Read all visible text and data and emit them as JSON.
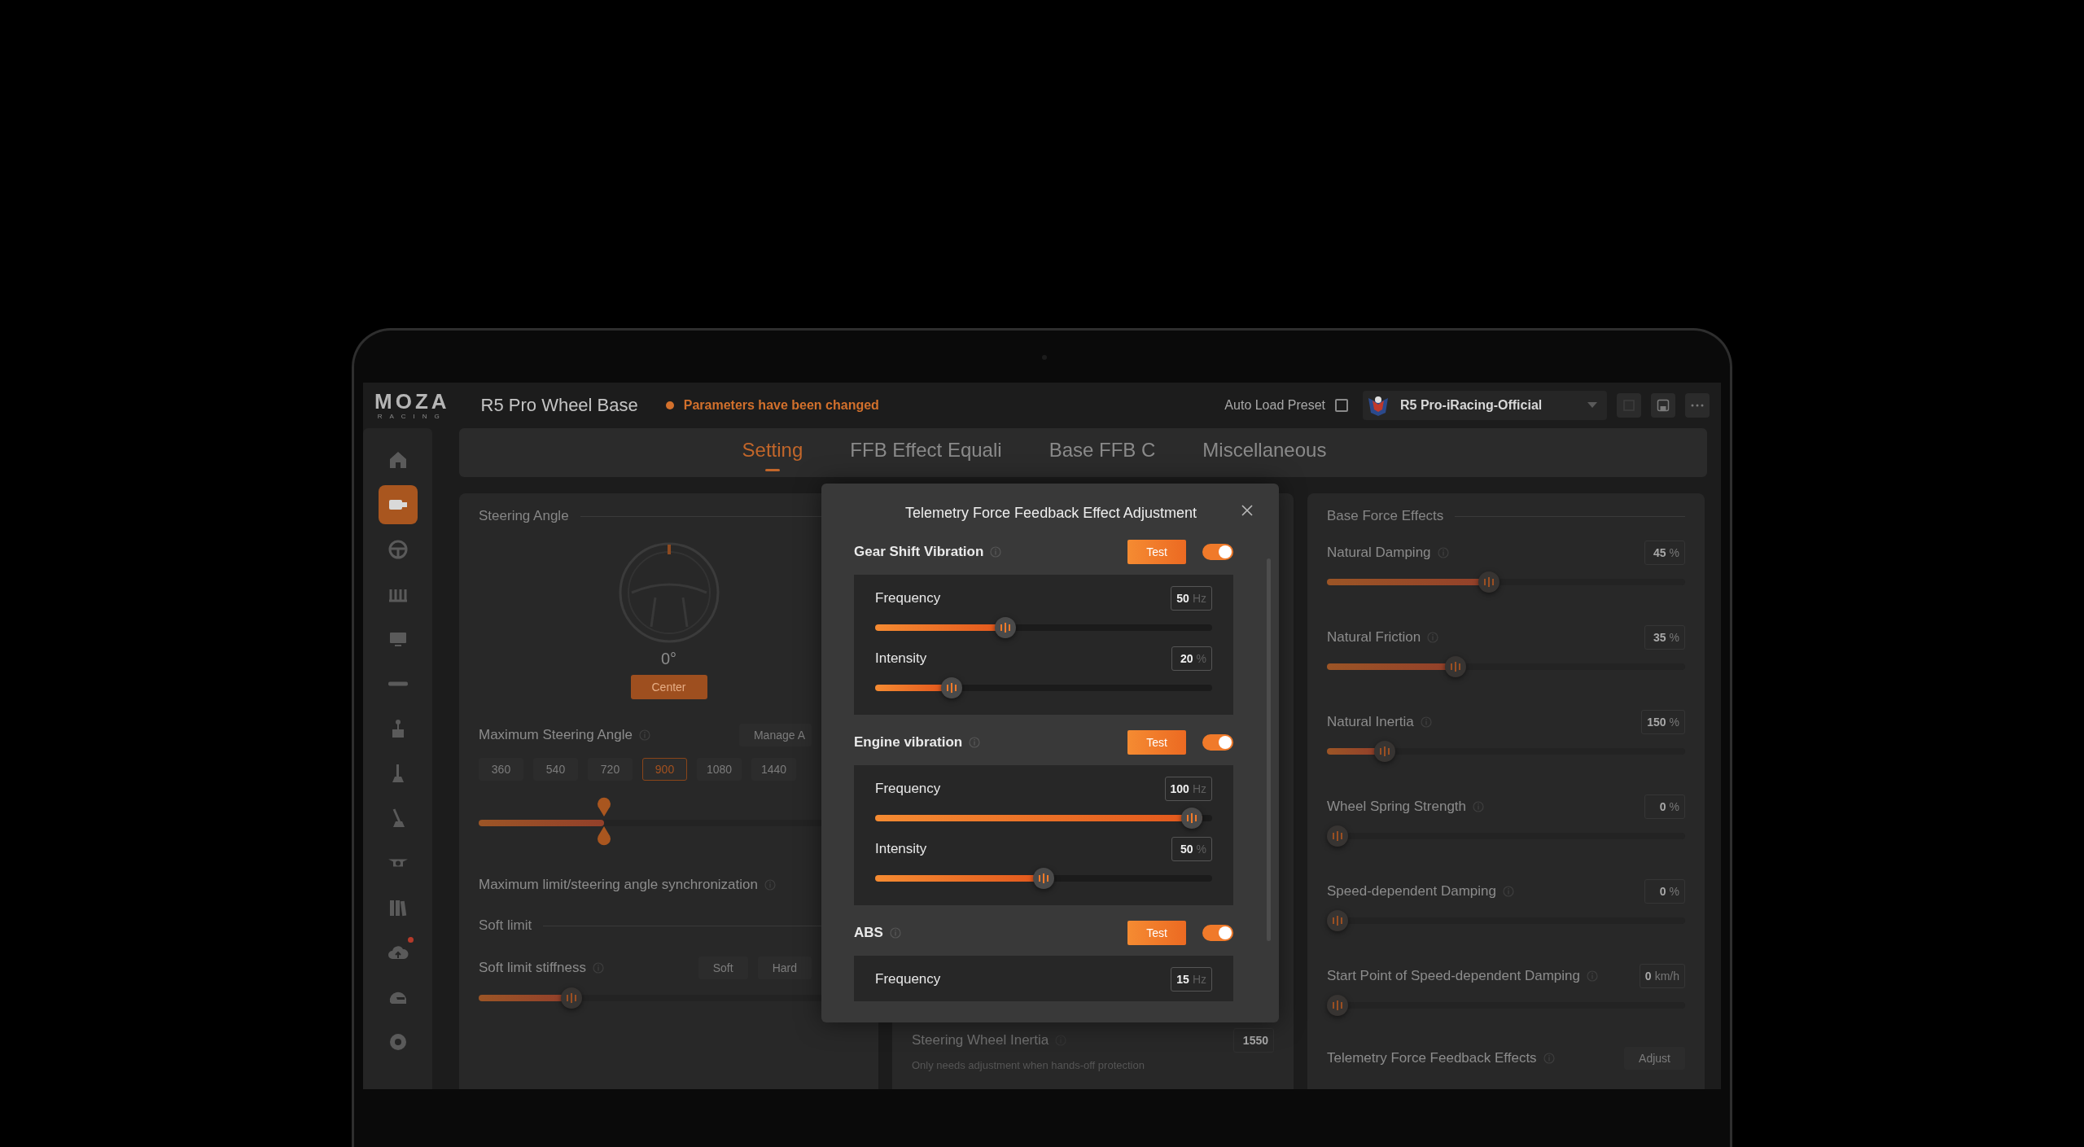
{
  "title_bar": {
    "logo": "MOZA",
    "logo_tagline": "RACING",
    "device": "R5 Pro Wheel Base",
    "status": "Parameters have been changed",
    "auto_load_preset": {
      "label": "Auto Load Preset",
      "checked": false
    },
    "preset": "R5 Pro-iRacing-Official"
  },
  "sidebar": {
    "items": [
      {
        "kind": "home",
        "selected": false,
        "notification": false
      },
      {
        "kind": "wheelbase",
        "selected": true,
        "notification": false
      },
      {
        "kind": "wheel",
        "selected": false,
        "notification": false
      },
      {
        "kind": "pedals",
        "selected": false,
        "notification": false
      },
      {
        "kind": "dashboard",
        "selected": false,
        "notification": false
      },
      {
        "kind": "bar",
        "selected": false,
        "notification": false
      },
      {
        "kind": "shifter",
        "selected": false,
        "notification": false
      },
      {
        "kind": "handbrake",
        "selected": false,
        "notification": false
      },
      {
        "kind": "lever",
        "selected": false,
        "notification": false
      },
      {
        "kind": "rim",
        "selected": false,
        "notification": false
      },
      {
        "kind": "library",
        "selected": false,
        "notification": false
      },
      {
        "kind": "cloud",
        "selected": false,
        "notification": true
      },
      {
        "kind": "helmet",
        "selected": false,
        "notification": false
      },
      {
        "kind": "settings",
        "selected": false,
        "notification": false
      }
    ]
  },
  "tabs": [
    {
      "label": "Setting",
      "selected": true
    },
    {
      "label": "FFB Effect Equali",
      "selected": false
    },
    {
      "label": "Base FFB C",
      "selected": false
    },
    {
      "label": "Miscellaneous",
      "selected": false
    }
  ],
  "steering_panel": {
    "title": "Steering Angle",
    "angle": "0°",
    "center_button": "Center",
    "max_angle_label": "Maximum Steering Angle",
    "manage_button": "Manage A",
    "angle_options": [
      {
        "label": "360",
        "selected": false
      },
      {
        "label": "540",
        "selected": false
      },
      {
        "label": "720",
        "selected": false
      },
      {
        "label": "900",
        "selected": true
      },
      {
        "label": "1080",
        "selected": false
      },
      {
        "label": "1440",
        "selected": false
      }
    ],
    "angle_slider": {
      "level": 0.31
    },
    "sync_label": "Maximum limit/steering angle synchronization",
    "soft_limit_title": "Soft limit",
    "stiffness_label": "Soft limit stiffness",
    "stiffness_options": [
      "Soft",
      "Hard"
    ],
    "stiffness_slider": {
      "level": 0.23
    }
  },
  "middle_panel": {
    "label": "Steering Wheel Inertia",
    "value": "1550",
    "description": "Only needs adjustment when hands-off protection"
  },
  "base_force_panel": {
    "title": "Base Force Effects",
    "settings": [
      {
        "label": "Natural Damping",
        "value": "45",
        "unit": "%",
        "level": 0.45
      },
      {
        "label": "Natural Friction",
        "value": "35",
        "unit": "%",
        "level": 0.35
      },
      {
        "label": "Natural Inertia",
        "value": "150",
        "unit": "%",
        "level": 0.14
      },
      {
        "label": "Wheel Spring Strength",
        "value": "0",
        "unit": "%",
        "level": 0
      },
      {
        "label": "Speed-dependent Damping",
        "value": "0",
        "unit": "%",
        "level": 0
      },
      {
        "label": "Start Point of Speed-dependent Damping",
        "value": "0",
        "unit": "km/h",
        "level": 0
      }
    ],
    "telemetry_label": "Telemetry Force Feedback Effects",
    "adjust_button": "Adjust"
  },
  "dialog": {
    "title": "Telemetry Force Feedback Effect Adjustment",
    "effects": [
      {
        "name": "Gear Shift Vibration",
        "test_button": "Test",
        "on": true,
        "params": [
          {
            "label": "Frequency",
            "value": "50",
            "unit": "Hz",
            "level": 0.38
          },
          {
            "label": "Intensity",
            "value": "20",
            "unit": "%",
            "level": 0.21
          }
        ]
      },
      {
        "name": "Engine vibration",
        "test_button": "Test",
        "on": true,
        "params": [
          {
            "label": "Frequency",
            "value": "100",
            "unit": "Hz",
            "level": 0.97
          },
          {
            "label": "Intensity",
            "value": "50",
            "unit": "%",
            "level": 0.5
          }
        ]
      },
      {
        "name": "ABS",
        "test_button": "Test",
        "on": true,
        "params": [
          {
            "label": "Frequency",
            "value": "15",
            "unit": "Hz"
          }
        ]
      }
    ]
  }
}
